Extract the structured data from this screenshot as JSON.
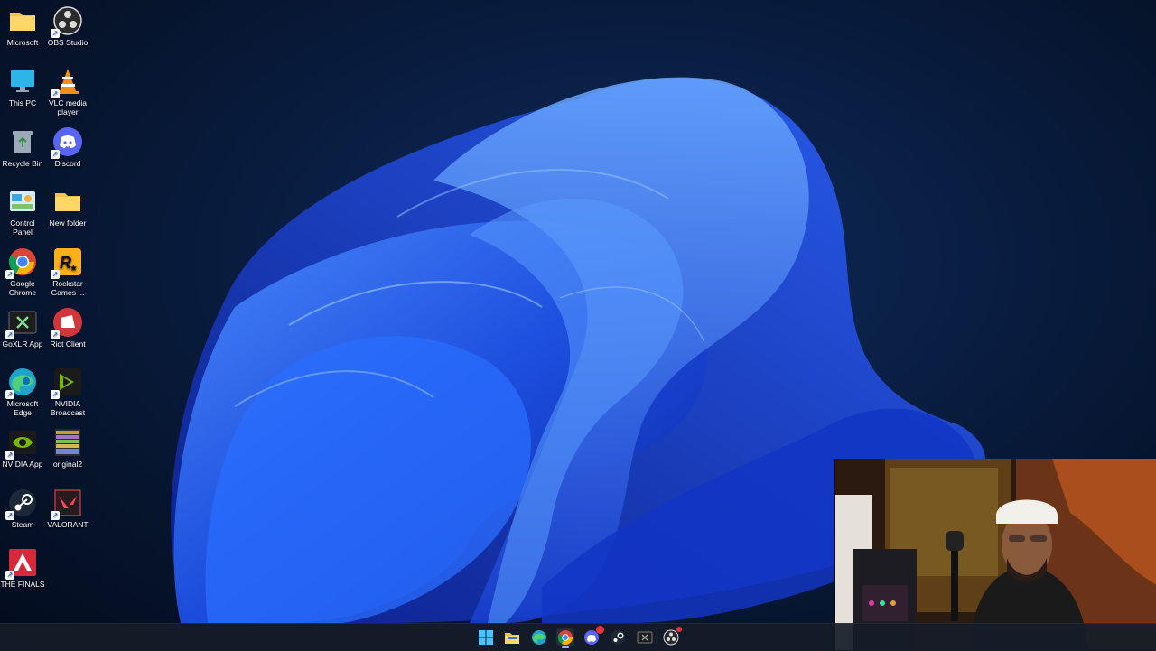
{
  "desktop": {
    "icons": [
      {
        "label": "Microsoft",
        "icon": "folder-icon",
        "color": "#f4c542"
      },
      {
        "label": "OBS Studio",
        "icon": "obs-icon",
        "color": "#2b2b2b"
      },
      {
        "label": "This PC",
        "icon": "monitor-icon",
        "color": "#2fb4e8"
      },
      {
        "label": "VLC media player",
        "icon": "vlc-cone-icon",
        "color": "#f28c1b"
      },
      {
        "label": "Recycle Bin",
        "icon": "recycle-bin-icon",
        "color": "#9aa7b6"
      },
      {
        "label": "Discord",
        "icon": "discord-icon",
        "color": "#5865f2"
      },
      {
        "label": "Control Panel",
        "icon": "control-panel-icon",
        "color": "#3fa4e0"
      },
      {
        "label": "New folder",
        "icon": "folder-icon",
        "color": "#f4c542"
      },
      {
        "label": "Google Chrome",
        "icon": "chrome-icon",
        "color": "#4285f4"
      },
      {
        "label": "Rockstar Games ...",
        "icon": "rockstar-icon",
        "color": "#fcaf17"
      },
      {
        "label": "GoXLR App",
        "icon": "goxlr-icon",
        "color": "#1d1d1d"
      },
      {
        "label": "Riot Client",
        "icon": "riot-icon",
        "color": "#d13639"
      },
      {
        "label": "Microsoft Edge",
        "icon": "edge-icon",
        "color": "#1fa3c9"
      },
      {
        "label": "NVIDIA Broadcast",
        "icon": "nvidia-broadcast-icon",
        "color": "#76b900"
      },
      {
        "label": "NVIDIA App",
        "icon": "nvidia-icon",
        "color": "#76b900"
      },
      {
        "label": "original2",
        "icon": "image-file-icon",
        "color": "#b8a040"
      },
      {
        "label": "Steam",
        "icon": "steam-icon",
        "color": "#1b2838"
      },
      {
        "label": "VALORANT",
        "icon": "valorant-icon",
        "color": "#ff4655"
      },
      {
        "label": "THE FINALS",
        "icon": "the-finals-icon",
        "color": "#d9283a"
      }
    ]
  },
  "taskbar": {
    "items": [
      {
        "name": "start-icon",
        "active": false
      },
      {
        "name": "file-explorer-icon",
        "active": false
      },
      {
        "name": "edge-icon",
        "active": false
      },
      {
        "name": "chrome-icon",
        "active": true
      },
      {
        "name": "discord-icon",
        "active": false,
        "badge": "99"
      },
      {
        "name": "steam-icon",
        "active": false
      },
      {
        "name": "goxlr-icon",
        "active": false
      },
      {
        "name": "obs-icon",
        "active": false
      }
    ]
  },
  "colors": {
    "accent": "#1a5fd6",
    "bloom_light": "#3a7bff",
    "bloom_dark": "#0b2fb0"
  }
}
